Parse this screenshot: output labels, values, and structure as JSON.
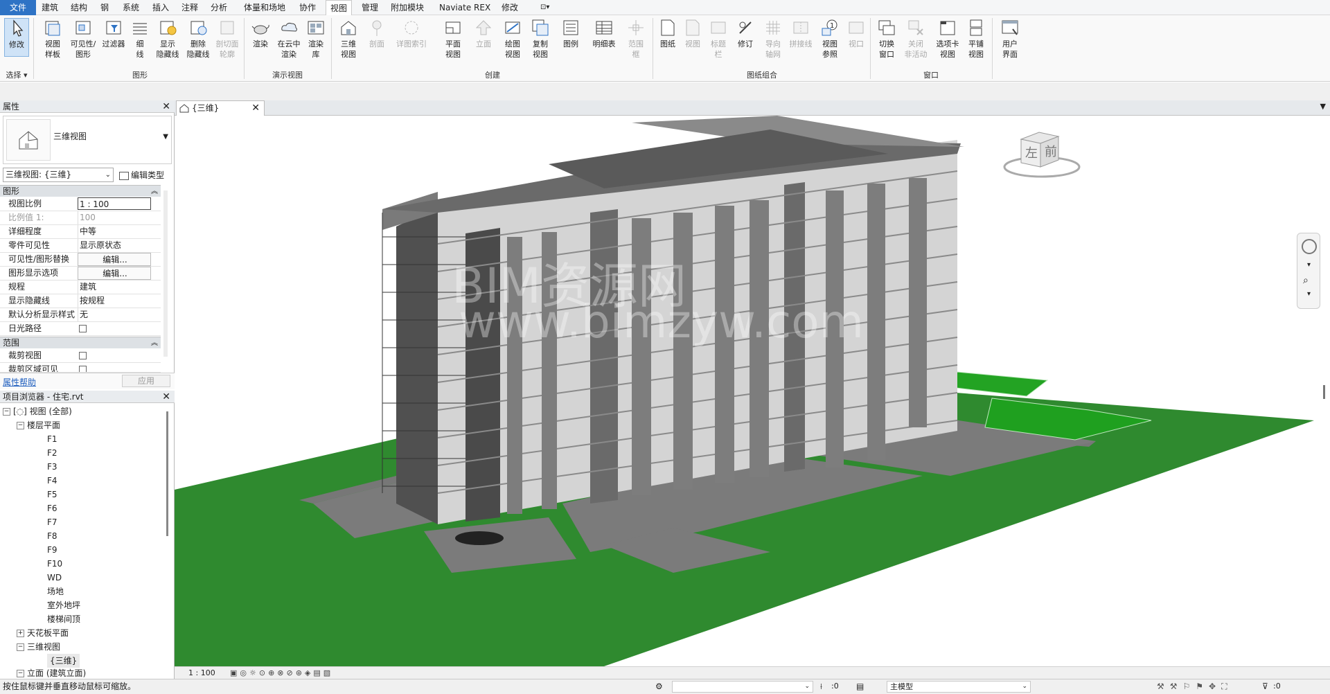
{
  "menu": {
    "items": [
      "文件",
      "建筑",
      "结构",
      "钢",
      "系统",
      "插入",
      "注释",
      "分析",
      "体量和场地",
      "协作",
      "视图",
      "管理",
      "附加模块",
      "Naviate REX",
      "修改"
    ],
    "active": "视图",
    "extra_icon": "dropdown-box-icon"
  },
  "ribbon": {
    "select": {
      "modify_label": "修改",
      "select_label": "选择 ▾"
    },
    "graphics": {
      "label": "图形",
      "buttons": [
        "视图\n样板",
        "可见性/\n图形",
        "过滤器",
        "细\n线",
        "显示\n隐藏线",
        "删除\n隐藏线",
        "剖切面\n轮廓"
      ]
    },
    "presentation": {
      "label": "演示视图",
      "buttons": [
        "渲染",
        "在云中\n渲染",
        "渲染\n库"
      ]
    },
    "create": {
      "label": "创建",
      "buttons": [
        "三维\n视图",
        "剖面",
        "详图索引",
        "平面\n视图",
        "立面",
        "绘图\n视图",
        "复制\n视图",
        "图例",
        "明细表",
        "范围\n框"
      ]
    },
    "sheet": {
      "label": "图纸组合",
      "buttons": [
        "图纸",
        "视图",
        "标题\n栏",
        "修订",
        "导向\n轴网",
        "拼接线",
        "视图\n参照",
        "视口"
      ]
    },
    "windows": {
      "label": "窗口",
      "buttons": [
        "切换\n窗口",
        "关闭\n非活动",
        "选项卡\n视图",
        "平铺\n视图",
        "用户\n界面"
      ]
    }
  },
  "properties": {
    "title": "属性",
    "type_name": "三维视图",
    "instance_selector": "三维视图: {三维}",
    "edit_type": "编辑类型",
    "sections": {
      "graphics": "图形",
      "extents": "范围"
    },
    "rows": [
      {
        "k": "视图比例",
        "v": "1 : 100"
      },
      {
        "k": "比例值 1:",
        "v": "100"
      },
      {
        "k": "详细程度",
        "v": "中等"
      },
      {
        "k": "零件可见性",
        "v": "显示原状态"
      },
      {
        "k": "可见性/图形替换",
        "v": "编辑..."
      },
      {
        "k": "图形显示选项",
        "v": "编辑..."
      },
      {
        "k": "规程",
        "v": "建筑"
      },
      {
        "k": "显示隐藏线",
        "v": "按规程"
      },
      {
        "k": "默认分析显示样式",
        "v": "无"
      },
      {
        "k": "日光路径",
        "v": ""
      }
    ],
    "extent_rows": [
      {
        "k": "裁剪视图"
      },
      {
        "k": "裁剪区域可见"
      }
    ],
    "help": "属性帮助",
    "apply": "应用"
  },
  "browser": {
    "title": "项目浏览器 - 住宅.rvt",
    "root": "视图 (全部)",
    "floor_plans": "楼层平面",
    "levels": [
      "F1",
      "F2",
      "F3",
      "F4",
      "F5",
      "F6",
      "F7",
      "F8",
      "F9",
      "F10",
      "WD",
      "场地",
      "室外地坪",
      "楼梯间顶"
    ],
    "ceiling_plans": "天花板平面",
    "views_3d": "三维视图",
    "view_3d_item": "{三维}",
    "elevations": "立面 (建筑立面)"
  },
  "view": {
    "tab": "{三维}",
    "viewcube": {
      "left": "左",
      "front": "前"
    },
    "scale": "1 : 100",
    "watermark_line1": "BIM资源网",
    "watermark_line2": "www.bimzyw.com"
  },
  "status": {
    "message": "按住鼠标键并垂直移动鼠标可缩放。",
    "select_count": ":0",
    "model": "主模型",
    "filter_count": ":0"
  },
  "colors": {
    "file_tab": "#2e73c5",
    "ground": "#2f8a2f",
    "road": "#7b7b7b",
    "building_light": "#dcdcdc",
    "building_dark": "#4a4a4a",
    "accent": "#86b3e0"
  }
}
